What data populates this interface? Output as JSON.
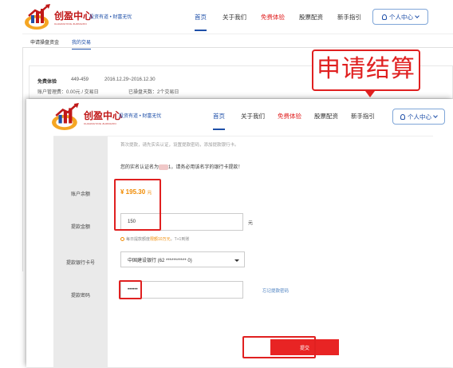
{
  "brand": {
    "name": "创盈中心",
    "sub": "CHUANGYING ZHONGXIN",
    "slogan": "投资有道 • 财富无忧"
  },
  "nav": {
    "home": "首页",
    "about": "关于我们",
    "trial": "免费体验",
    "stock": "股票配资",
    "guide": "新手指引"
  },
  "user_center": "个人中心",
  "back": {
    "subtabs": [
      "申请操盘资金",
      "我的交易"
    ],
    "plan_name": "免费体验",
    "plan_code": "449-459",
    "plan_dates": "2016.12.29~2016.12.30",
    "fee": "账户管理费：0.00元 / 交易日",
    "days": "已操盘天数：2个交易日"
  },
  "form": {
    "notice": "首次提款，请先实名认证，设置提款密码，添加提款银行卡。",
    "realname_prefix": "您的实名认证名为",
    "realname_suffix": "1，请务必用该名字的银行卡提款！",
    "labels": {
      "balance": "账户余额",
      "amount": "提款金额",
      "bank": "提款银行卡号",
      "password": "提款密码"
    },
    "balance_value": "¥ 195.30",
    "balance_unit": "元",
    "amount_value": "150",
    "amount_unit": "元",
    "hint_prefix": "每日提款额度",
    "hint_warn": "限额10万元",
    "hint_suffix": "，T+1到账",
    "bank_value": "中国建设银行 (62         ***********    0)",
    "password_value": "••••••",
    "forgot": "忘记提款密码",
    "submit": "提交"
  },
  "callout": "申请结算",
  "colors": {
    "brand_red": "#c01818",
    "nav_blue": "#1e4fa8",
    "highlight": "#e02020",
    "balance": "#f08a00"
  }
}
